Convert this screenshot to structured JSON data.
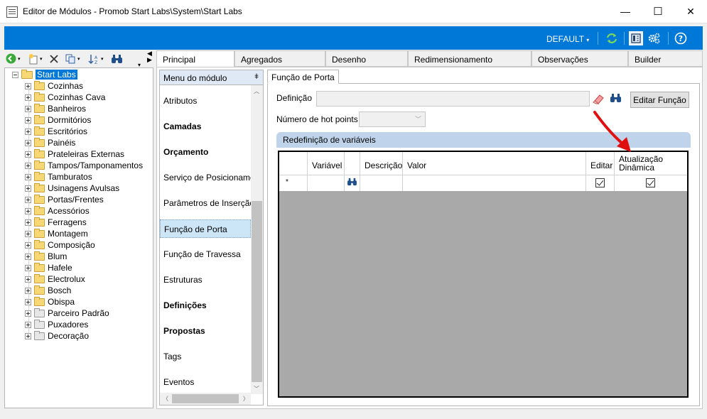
{
  "window": {
    "title": "Editor de Módulos - Promob Start Labs\\System\\Start Labs",
    "minimize": "—",
    "maximize": "☐",
    "close": "✕"
  },
  "header": {
    "profile": "DEFAULT",
    "profile_caret": "▾",
    "accent_color": "#0078d7"
  },
  "toolbar": {
    "icons": [
      "add-green-icon",
      "new-item-icon",
      "delete-icon",
      "copy-icon",
      "sort-icon",
      "search-binoculars-icon"
    ]
  },
  "tree": {
    "root": "Start Labs",
    "items": [
      {
        "label": "Cozinhas",
        "folder": "yellow"
      },
      {
        "label": "Cozinhas Cava",
        "folder": "yellow"
      },
      {
        "label": "Banheiros",
        "folder": "yellow"
      },
      {
        "label": "Dormitórios",
        "folder": "yellow"
      },
      {
        "label": "Escritórios",
        "folder": "yellow"
      },
      {
        "label": "Painéis",
        "folder": "yellow"
      },
      {
        "label": "Prateleiras Externas",
        "folder": "yellow"
      },
      {
        "label": "Tampos/Tamponamentos",
        "folder": "yellow"
      },
      {
        "label": "Tamburatos",
        "folder": "yellow"
      },
      {
        "label": "Usinagens Avulsas",
        "folder": "yellow"
      },
      {
        "label": "Portas/Frentes",
        "folder": "yellow"
      },
      {
        "label": "Acessórios",
        "folder": "yellow"
      },
      {
        "label": "Ferragens",
        "folder": "yellow"
      },
      {
        "label": "Montagem",
        "folder": "yellow"
      },
      {
        "label": "Composição",
        "folder": "yellow"
      },
      {
        "label": "Blum",
        "folder": "yellow"
      },
      {
        "label": "Hafele",
        "folder": "yellow"
      },
      {
        "label": "Electrolux",
        "folder": "yellow"
      },
      {
        "label": "Bosch",
        "folder": "yellow"
      },
      {
        "label": "Obispa",
        "folder": "yellow"
      },
      {
        "label": "Parceiro Padrão",
        "folder": "gray"
      },
      {
        "label": "Puxadores",
        "folder": "gray"
      },
      {
        "label": "Decoração",
        "folder": "gray"
      }
    ]
  },
  "tabs": [
    "Principal",
    "Agregados",
    "Desenho",
    "Redimensionamento",
    "Observações",
    "Builder"
  ],
  "menu": {
    "header": "Menu do módulo",
    "pin": "ǂ",
    "items": [
      {
        "label": "Atributos",
        "bold": false
      },
      {
        "label": "Camadas",
        "bold": true
      },
      {
        "label": "Orçamento",
        "bold": true
      },
      {
        "label": "Serviço de Posicionamento",
        "bold": false
      },
      {
        "label": "Parâmetros de Inserção",
        "bold": false
      },
      {
        "label": "Função de Porta",
        "bold": false,
        "selected": true
      },
      {
        "label": "Função de Travessa",
        "bold": false
      },
      {
        "label": "Estruturas",
        "bold": false
      },
      {
        "label": "Definições",
        "bold": true
      },
      {
        "label": "Propostas",
        "bold": true
      },
      {
        "label": "Tags",
        "bold": false
      },
      {
        "label": "Eventos",
        "bold": false
      }
    ]
  },
  "function_panel": {
    "tab": "Função de Porta",
    "definition_label": "Definição",
    "definition_value": "",
    "edit_button": "Editar Função",
    "hotpoints_label": "Número de hot points",
    "hotpoints_value": "",
    "group_title": "Redefinição de variáveis",
    "columns": [
      "Variável",
      "",
      "Descrição",
      "Valor",
      "Editar",
      "Atualização Dinâmica"
    ],
    "row": {
      "marker": "*",
      "variavel": "",
      "descricao": "",
      "valor": "",
      "editar": true,
      "atualizacao": true
    }
  }
}
